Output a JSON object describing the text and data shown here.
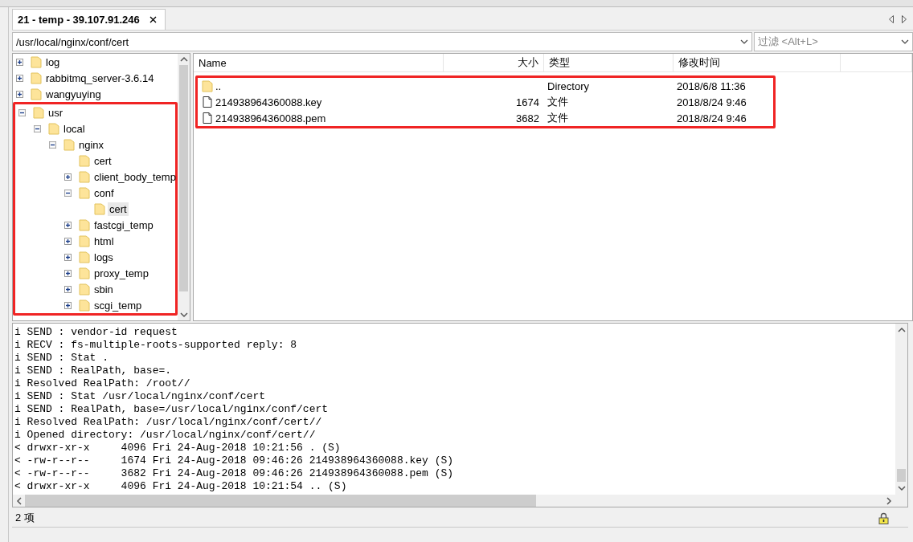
{
  "tab_bar": {
    "tabs": [
      {
        "label": "21 - temp - 39.107.91.246",
        "selected": true
      }
    ]
  },
  "path_bar": {
    "path": "/usr/local/nginx/conf/cert",
    "filter_placeholder": "过滤 <Alt+L>"
  },
  "tree": {
    "items": [
      {
        "children": [
          {
            "label": "log",
            "expanded": false,
            "selected": false
          },
          {
            "label": "rabbitmq_server-3.6.14",
            "expanded": false,
            "selected": false
          },
          {
            "label": "wangyuying",
            "expanded": false,
            "selected": false
          }
        ]
      },
      {
        "label": "usr",
        "expanded": true,
        "selected": false,
        "highlighted": true,
        "children": [
          {
            "label": "local",
            "expanded": true,
            "selected": false,
            "children": [
              {
                "label": "nginx",
                "expanded": true,
                "selected": false,
                "children": [
                  {
                    "label": "cert",
                    "expandable": false,
                    "selected": false
                  },
                  {
                    "label": "client_body_temp",
                    "expanded": false,
                    "selected": false
                  },
                  {
                    "label": "conf",
                    "expanded": true,
                    "selected": false,
                    "children": [
                      {
                        "label": "cert",
                        "expandable": false,
                        "selected": true
                      }
                    ]
                  },
                  {
                    "label": "fastcgi_temp",
                    "expanded": false,
                    "selected": false
                  },
                  {
                    "label": "html",
                    "expanded": false,
                    "selected": false
                  },
                  {
                    "label": "logs",
                    "expanded": false,
                    "selected": false
                  },
                  {
                    "label": "proxy_temp",
                    "expanded": false,
                    "selected": false
                  },
                  {
                    "label": "sbin",
                    "expanded": false,
                    "selected": false
                  },
                  {
                    "label": "scgi_temp",
                    "expanded": false,
                    "selected": false
                  }
                ]
              }
            ]
          }
        ]
      }
    ]
  },
  "file_list": {
    "columns": [
      "Name",
      "大小",
      "类型",
      "修改时间"
    ],
    "highlighted": true,
    "rows": [
      {
        "kind": "folder",
        "name": "..",
        "type": "Directory",
        "modified": "2018/6/8 11:36"
      },
      {
        "kind": "file",
        "name": "214938964360088.key",
        "size": "1674",
        "type": "文件",
        "modified": "2018/8/24 9:46"
      },
      {
        "kind": "file",
        "name": "214938964360088.pem",
        "size": "3682",
        "type": "文件",
        "modified": "2018/8/24 9:46"
      }
    ]
  },
  "log": {
    "lines": [
      "i SEND : vendor-id request",
      "i RECV : fs-multiple-roots-supported reply: 8",
      "i SEND : Stat .",
      "i SEND : RealPath, base=.",
      "i Resolved RealPath: /root//",
      "i SEND : Stat /usr/local/nginx/conf/cert",
      "i SEND : RealPath, base=/usr/local/nginx/conf/cert",
      "i Resolved RealPath: /usr/local/nginx/conf/cert//",
      "i Opened directory: /usr/local/nginx/conf/cert//",
      "< drwxr-xr-x     4096 Fri 24-Aug-2018 10:21:56 . (S)",
      "< -rw-r--r--     1674 Fri 24-Aug-2018 09:46:26 214938964360088.key (S)",
      "< -rw-r--r--     3682 Fri 24-Aug-2018 09:46:26 214938964360088.pem (S)",
      "< drwxr-xr-x     4096 Fri 24-Aug-2018 10:21:54 .. (S)"
    ]
  },
  "status_bar": {
    "text": "2 项"
  }
}
